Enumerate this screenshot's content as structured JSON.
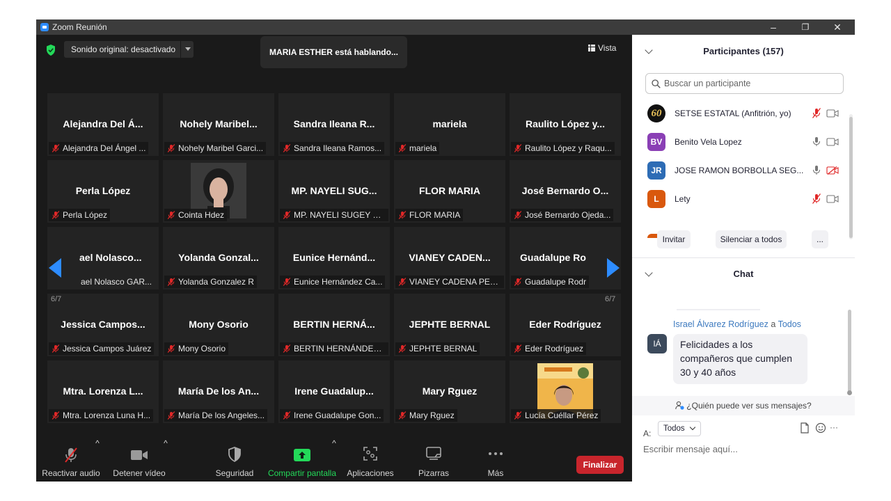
{
  "window": {
    "title": "Zoom Reunión",
    "minimize": "–",
    "restore": "❐",
    "close": "✕"
  },
  "meeting": {
    "audio_mode": "Sonido original: desactivado",
    "speaking": "MARIA ESTHER está hablando...",
    "view_label": "Vista",
    "page_left": "6/7",
    "page_right": "6/7"
  },
  "tiles": [
    {
      "big": "Alejandra Del Á...",
      "tag": "Alejandra Del Ángel ..."
    },
    {
      "big": "Nohely  Maribel...",
      "tag": "Nohely Maribel Garci..."
    },
    {
      "big": "Sandra  Ileana  R...",
      "tag": "Sandra Ileana Ramos..."
    },
    {
      "big": "mariela",
      "tag": "mariela"
    },
    {
      "big": "Raulito  López  y...",
      "tag": "Raulito López y Raqu..."
    },
    {
      "big": "Perla López",
      "tag": "Perla López"
    },
    {
      "big": "",
      "tag": "Cointa Hdez"
    },
    {
      "big": "MP.  NAYELI  SUG...",
      "tag": "MP. NAYELI SUGEY G..."
    },
    {
      "big": "FLOR MARIA",
      "tag": "FLOR MARIA"
    },
    {
      "big": "José  Bernardo  O...",
      "tag": "José Bernardo Ojeda..."
    },
    {
      "big": "ael  Nolasco...",
      "tag": "ael Nolasco GAR..."
    },
    {
      "big": "Yolanda  Gonzal...",
      "tag": "Yolanda Gonzalez R"
    },
    {
      "big": "Eunice  Hernánd...",
      "tag": "Eunice Hernández Ca..."
    },
    {
      "big": "VIANEY  CADEN...",
      "tag": "VIANEY CADENA PEÑA"
    },
    {
      "big": "Guadalupe  Ro",
      "tag": "Guadalupe Rodr"
    },
    {
      "big": "Jessica  Campos...",
      "tag": "Jessica Campos Juárez"
    },
    {
      "big": "Mony Osorio",
      "tag": "Mony Osorio"
    },
    {
      "big": "BERTIN  HERNÁ...",
      "tag": "BERTIN HERNÁNDEZ ..."
    },
    {
      "big": "JEPHTE BERNAL",
      "tag": "JEPHTE BERNAL"
    },
    {
      "big": "Eder Rodríguez",
      "tag": "Eder Rodríguez"
    },
    {
      "big": "Mtra.  Lorenza  L...",
      "tag": "Mtra. Lorenza Luna H..."
    },
    {
      "big": "María  De  los  An...",
      "tag": "María De los Angeles..."
    },
    {
      "big": "Irene  Guadalup...",
      "tag": "Irene Guadalupe Gon..."
    },
    {
      "big": "Mary Rguez",
      "tag": "Mary Rguez"
    },
    {
      "big": "",
      "tag": "Lucía Cuéllar Pérez"
    }
  ],
  "toolbar": {
    "unmute": "Reactivar audio",
    "stop_video": "Detener vídeo",
    "security": "Seguridad",
    "share": "Compartir pantalla",
    "apps": "Aplicaciones",
    "whiteboards": "Pizarras",
    "more": "Más",
    "end": "Finalizar",
    "chevron": "^"
  },
  "participants": {
    "header": "Participantes (157)",
    "search_placeholder": "Buscar un participante",
    "list": [
      {
        "initials": "60",
        "name": "SETSE ESTATAL (Anfitrión, yo)",
        "color": "#111111"
      },
      {
        "initials": "BV",
        "name": "Benito Vela Lopez",
        "color": "#8a3fb5"
      },
      {
        "initials": "JR",
        "name": "JOSE RAMON BORBOLLA SEG...",
        "color": "#2d6cb5"
      },
      {
        "initials": "L",
        "name": "Lety",
        "color": "#d9580d"
      }
    ],
    "invite": "Invitar",
    "mute_all": "Silenciar a todos",
    "more": "..."
  },
  "chat": {
    "header": "Chat",
    "sender": "Israel Álvarez Rodríguez",
    "to_word": "a",
    "recipient": "Todos",
    "avatar": "IÁ",
    "message": "Felicidades a los compañeros que cumplen 30 y 40 años",
    "who_sees": "¿Quién puede ver sus mensajes?",
    "to_label": "A:",
    "to_value": "Todos",
    "input_placeholder": "Escribir mensaje aquí...",
    "more": "···"
  },
  "colors": {
    "muted_red": "#e02828",
    "share_green": "#23d959",
    "end_red": "#c8252c",
    "arrow_blue": "#2d8cff",
    "link_blue": "#3d7abf"
  }
}
